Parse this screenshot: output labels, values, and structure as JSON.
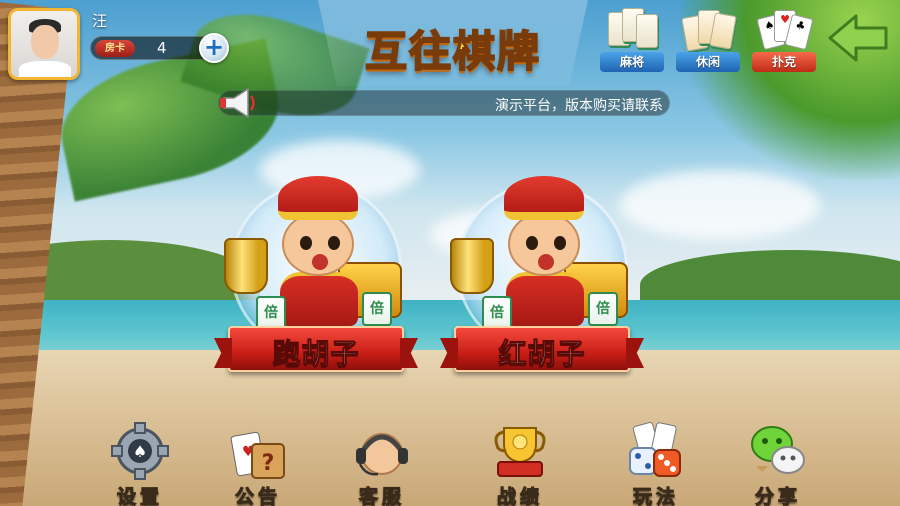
{
  "user": {
    "name": "汪"
  },
  "room_card": {
    "tag": "房卡",
    "count": "4",
    "add_symbol": "+"
  },
  "app_title": "互往棋牌",
  "categories": [
    {
      "label": "麻将",
      "icon": "mahjong-tiles-icon",
      "color": "#2e7fcf"
    },
    {
      "label": "休闲",
      "icon": "leisure-tiles-icon",
      "color": "#2e7fcf"
    },
    {
      "label": "扑克",
      "icon": "poker-cards-icon",
      "color": "#e0462e"
    }
  ],
  "notice": {
    "text": "演示平台，版本购买请联系"
  },
  "games": [
    {
      "name": "跑胡子",
      "badge": "倍"
    },
    {
      "name": "红胡子",
      "badge": "倍"
    }
  ],
  "menu": [
    {
      "label": "设置",
      "icon": "gear-icon"
    },
    {
      "label": "公告",
      "icon": "notice-cards-icon"
    },
    {
      "label": "客服",
      "icon": "headset-icon"
    },
    {
      "label": "战绩",
      "icon": "trophy-icon"
    },
    {
      "label": "玩法",
      "icon": "dice-icon"
    },
    {
      "label": "分享",
      "icon": "wechat-icon"
    }
  ],
  "colors": {
    "accent_gold": "#ffd938",
    "ribbon_red": "#c81e16",
    "back_arrow": "#8fd14f"
  }
}
